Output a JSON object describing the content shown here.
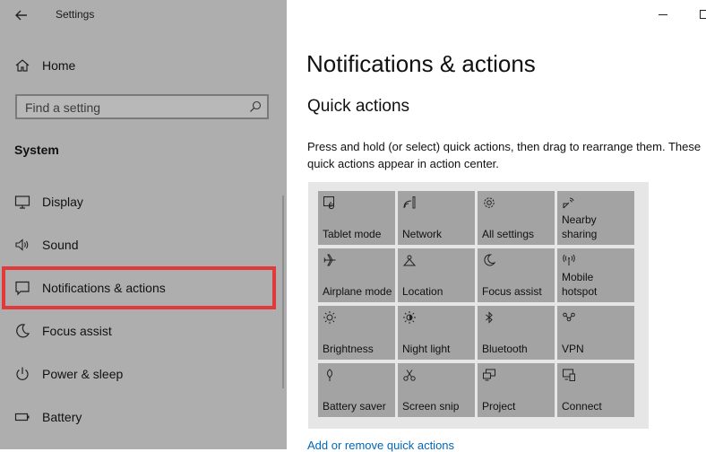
{
  "window": {
    "title": "Settings"
  },
  "sidebar": {
    "home_label": "Home",
    "search_placeholder": "Find a setting",
    "section_title": "System",
    "items": [
      {
        "label": "Display",
        "icon": "display-icon"
      },
      {
        "label": "Sound",
        "icon": "speaker-icon"
      },
      {
        "label": "Notifications & actions",
        "icon": "message-icon",
        "selected": true
      },
      {
        "label": "Focus assist",
        "icon": "moon-icon"
      },
      {
        "label": "Power & sleep",
        "icon": "power-icon"
      },
      {
        "label": "Battery",
        "icon": "battery-icon"
      }
    ]
  },
  "main": {
    "title": "Notifications & actions",
    "section_title": "Quick actions",
    "description": "Press and hold (or select) quick actions, then drag to rearrange them. These quick actions appear in action center.",
    "tiles": [
      {
        "label": "Tablet mode",
        "icon": "tablet-mode-icon"
      },
      {
        "label": "Network",
        "icon": "network-icon"
      },
      {
        "label": "All settings",
        "icon": "gear-icon"
      },
      {
        "label": "Nearby\nsharing",
        "icon": "nearby-sharing-icon"
      },
      {
        "label": "Airplane mode",
        "icon": "airplane-icon"
      },
      {
        "label": "Location",
        "icon": "location-icon"
      },
      {
        "label": "Focus assist",
        "icon": "moon-icon"
      },
      {
        "label": "Mobile\nhotspot",
        "icon": "hotspot-icon"
      },
      {
        "label": "Brightness",
        "icon": "sun-icon"
      },
      {
        "label": "Night light",
        "icon": "night-light-icon"
      },
      {
        "label": "Bluetooth",
        "icon": "bluetooth-icon"
      },
      {
        "label": "VPN",
        "icon": "vpn-icon"
      },
      {
        "label": "Battery saver",
        "icon": "battery-saver-icon"
      },
      {
        "label": "Screen snip",
        "icon": "scissors-icon"
      },
      {
        "label": "Project",
        "icon": "project-icon"
      },
      {
        "label": "Connect",
        "icon": "connect-icon"
      }
    ],
    "link_label": "Add or remove quick actions"
  },
  "colors": {
    "sidebar_bg": "#aeaeae",
    "tile_bg": "#a3a3a3",
    "grid_bg": "#e6e6e6",
    "highlight": "#e03a3a",
    "link": "#0067b8"
  }
}
